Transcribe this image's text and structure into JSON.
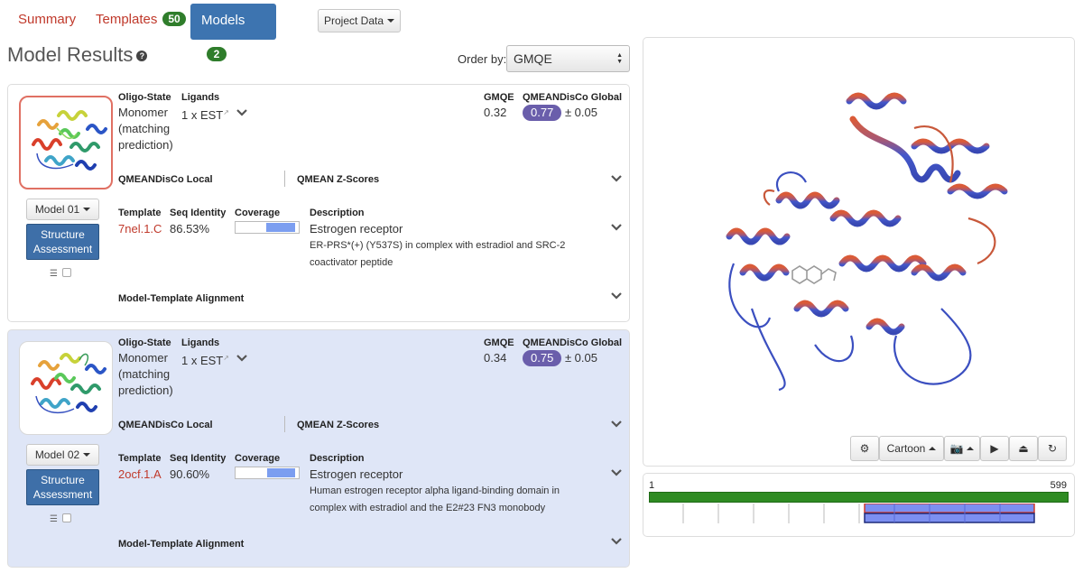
{
  "tabs": [
    {
      "label": "Summary"
    },
    {
      "label": "Templates",
      "count": "50"
    },
    {
      "label": "Models",
      "count": "2"
    }
  ],
  "project_data_label": "Project Data",
  "page_title": "Model Results",
  "order_by": {
    "label": "Order by:",
    "selected": "GMQE"
  },
  "headers": {
    "oligo": "Oligo-State",
    "ligands": "Ligands",
    "gmqe": "GMQE",
    "qmean_global": "QMEANDisCo Global",
    "qmean_local": "QMEANDisCo Local",
    "qmean_z": "QMEAN Z-Scores",
    "template": "Template",
    "seq_identity": "Seq Identity",
    "coverage": "Coverage",
    "description": "Description",
    "alignment": "Model-Template Alignment"
  },
  "models": [
    {
      "model_label": "Model 01",
      "structure_btn": "Structure Assessment",
      "oligo_lines": [
        "Monomer",
        "(matching",
        "prediction)"
      ],
      "ligand": "1 x EST",
      "gmqe": "0.32",
      "qmean": "0.77",
      "qmean_err": "± 0.05",
      "template": "7nel.1.C",
      "seq_identity": "86.53%",
      "coverage": 0.46,
      "desc_title": "Estrogen receptor",
      "desc_lines": [
        "ER-PRS*(+) (Y537S) in complex with estradiol and SRC-2",
        "coactivator peptide"
      ]
    },
    {
      "model_label": "Model 02",
      "structure_btn": "Structure Assessment",
      "oligo_lines": [
        "Monomer",
        "(matching",
        "prediction)"
      ],
      "ligand": "1 x EST",
      "gmqe": "0.34",
      "qmean": "0.75",
      "qmean_err": "± 0.05",
      "template": "2ocf.1.A",
      "seq_identity": "90.60%",
      "coverage": 0.44,
      "desc_title": "Estrogen receptor",
      "desc_lines": [
        "Human estrogen receptor alpha ligand-binding domain in",
        "complex with estradiol and the E2#23 FN3 monobody"
      ]
    }
  ],
  "viewer": {
    "render_mode": "Cartoon",
    "icons": [
      "gear-icon",
      "camera-icon",
      "play-icon",
      "eject-icon",
      "refresh-icon"
    ]
  },
  "sequence": {
    "start": "1",
    "end": "599",
    "full_color": "#2e8b22",
    "coverage_color": "#7c8ff0"
  },
  "colors": {
    "accent": "#3d74b0",
    "link_red": "#c0392b",
    "badge_green": "#2f7d2b",
    "qmean_purple": "#6a5eab"
  }
}
